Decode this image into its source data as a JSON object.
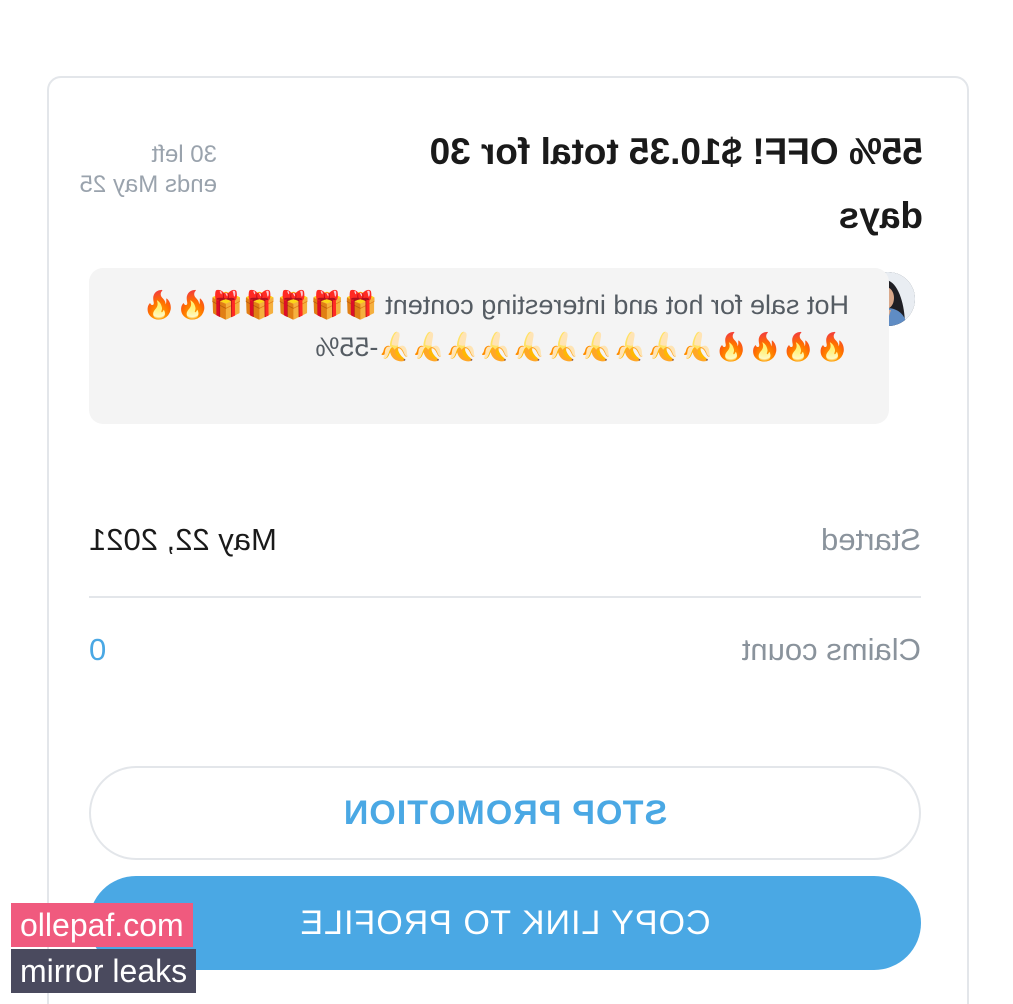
{
  "promotion": {
    "title": "55% OFF! $10.35 total for 30 days",
    "meta_left": "30 left",
    "meta_ends": "ends May 25",
    "message": "Hot sale for hot and interesting content 🎁🎁🎁🎁🎁🔥🔥🔥🔥🔥🔥🍌🍌🍌🍌🍌🍌🍌🍌🍌🍌-55%",
    "started_label": "Started",
    "started_value": "May 22, 2021",
    "claims_label": "Claims count",
    "claims_value": "0",
    "stop_button": "STOP PROMOTION",
    "copy_button": "COPY LINK TO PROFILE"
  },
  "watermark": {
    "line1": "ollepaf.com",
    "line2": "mirror leaks"
  },
  "colors": {
    "accent": "#4aa8e4",
    "label_gray": "#8a939c",
    "bubble_bg": "#f4f4f4",
    "border": "#e3e6ea",
    "watermark_pink": "#f05a7e",
    "watermark_dark": "#4a4a5e"
  },
  "icons": {
    "avatar": "user-avatar-photo"
  }
}
